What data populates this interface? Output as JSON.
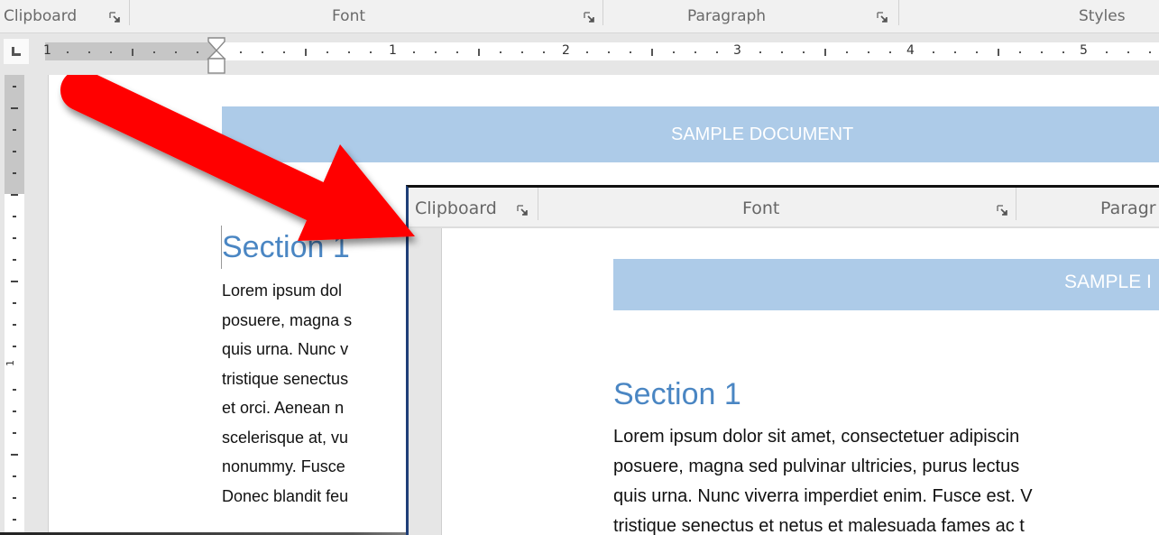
{
  "back_window": {
    "ribbon_groups": [
      {
        "label": "Clipboard",
        "has_launcher": true
      },
      {
        "label": "Font",
        "has_launcher": true
      },
      {
        "label": "Paragraph",
        "has_launcher": true
      },
      {
        "label": "Styles",
        "has_launcher": false
      }
    ],
    "ruler": {
      "numbers": [
        "1",
        "1",
        "2",
        "3",
        "4",
        "5"
      ],
      "vertical_numbers": [
        "1"
      ]
    },
    "document": {
      "banner_title": "SAMPLE DOCUMENT",
      "heading": "Section 1",
      "body_lines": [
        "Lorem ipsum dol",
        "posuere, magna s",
        "quis urna. Nunc v",
        "tristique senectus",
        "et orci. Aenean n",
        "scelerisque at, vu",
        "nonummy. Fusce",
        "Donec blandit feu"
      ]
    }
  },
  "front_window": {
    "ribbon_groups": [
      {
        "label": "Clipboard",
        "has_launcher": true
      },
      {
        "label": "Font",
        "has_launcher": true
      },
      {
        "label": "Paragr",
        "has_launcher": false
      }
    ],
    "document": {
      "banner_title": "SAMPLE I",
      "heading": "Section 1",
      "body_lines": [
        "Lorem ipsum dolor sit amet, consectetuer adipiscin",
        "posuere, magna sed pulvinar ultricies, purus lectus",
        "quis urna. Nunc viverra imperdiet enim. Fusce est. V",
        "tristique senectus et netus et malesuada fames ac t"
      ]
    }
  },
  "annotation": {
    "arrow_color": "#ff0000",
    "arrow_direction": "down-right"
  },
  "colors": {
    "banner": "#adcbe8",
    "heading": "#4a86c3",
    "ribbon_bg": "#f1f1f1"
  }
}
